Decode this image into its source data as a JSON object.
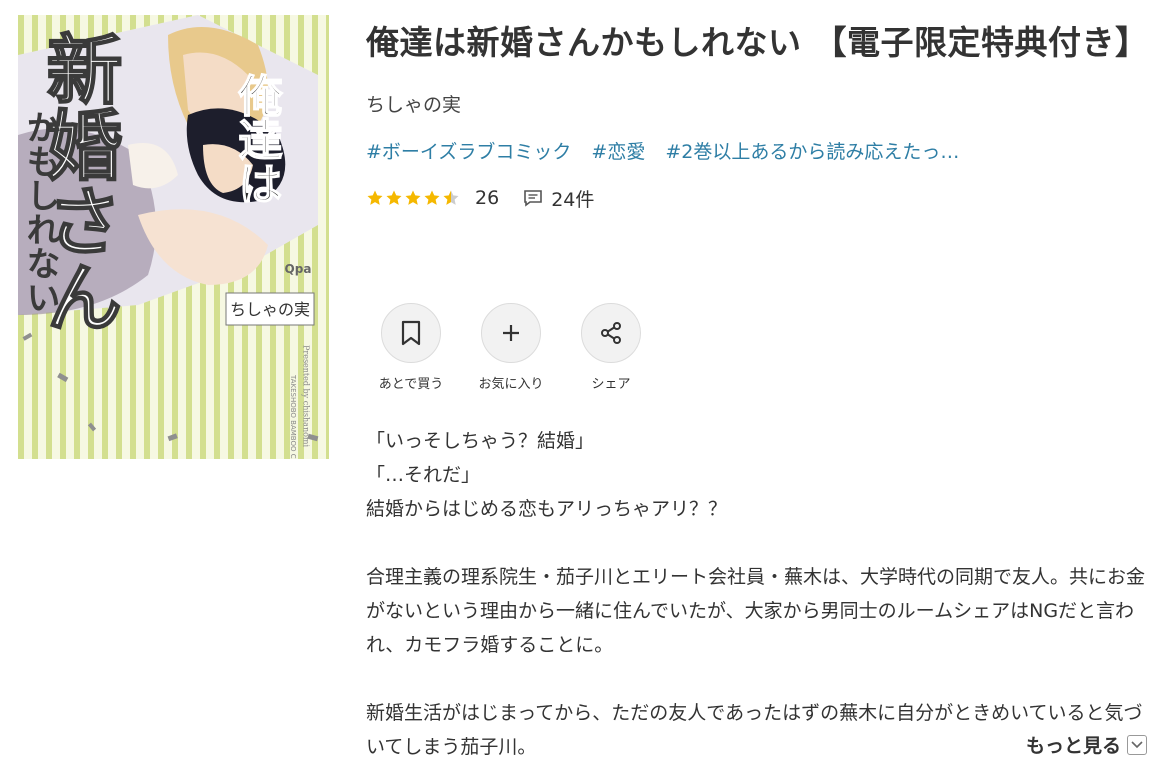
{
  "book": {
    "title": "俺達は新婚さんかもしれない 【電子限定特典付き】",
    "author": "ちしゃの実",
    "tags": [
      "#ボーイズラブコミック",
      "#恋愛",
      "#2巻以上あるから読み応えたっ…"
    ],
    "rating_stars": 4.5,
    "rating_count": "26",
    "review_count": "24件"
  },
  "cover": {
    "title_line1": "俺達は",
    "title_big": "新婚さん",
    "title_small": "かもしれない",
    "author_tag": "ちしゃの実",
    "publisher_logo": "Qpa",
    "imprint": "TAKESHOBO BAMBOO COMICS",
    "credit": "Presented by chishanomi"
  },
  "actions": [
    {
      "label": "あとで買う",
      "icon": "bookmark-icon"
    },
    {
      "label": "お気に入り",
      "icon": "plus-icon"
    },
    {
      "label": "シェア",
      "icon": "share-icon"
    }
  ],
  "description": {
    "lines": [
      "「いっそしちゃう？結婚」",
      "「…それだ」",
      "結婚からはじめる恋もアリっちゃアリ？？"
    ],
    "paragraph1": "合理主義の理系院生・茄子川とエリート会社員・蕪木は、大学時代の同期で友人。共にお金がないという理由から一緒に住んでいたが、大家から男同士のルームシェアはNGだと言われ、カモフラ婚することに。",
    "paragraph2": "新婚生活がはじまってから、ただの友人であったはずの蕪木に自分がときめいていると気づいてしまう茄子川。",
    "more_label": "もっと見る"
  },
  "colors": {
    "star": "#f5b800",
    "tag": "#2e7ea5",
    "cover_stripe": "#cfdc8a"
  }
}
